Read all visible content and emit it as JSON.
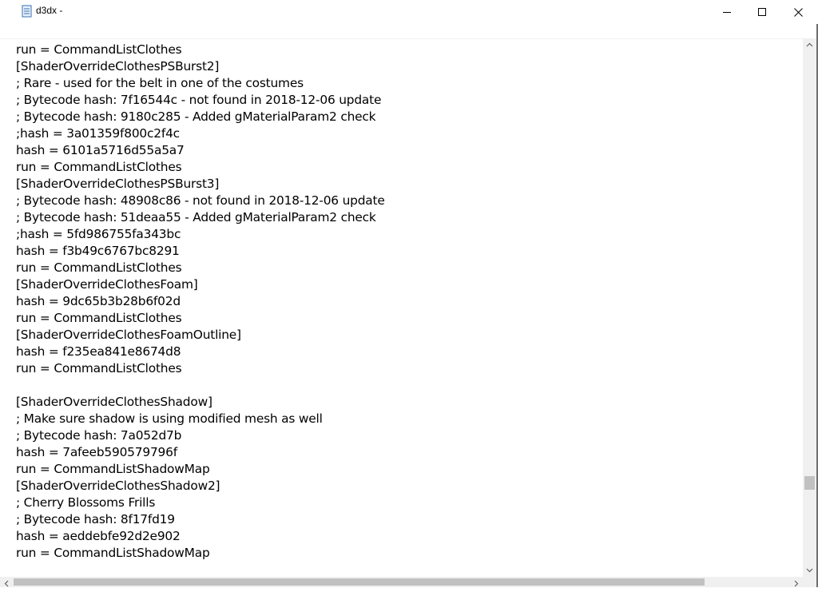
{
  "window": {
    "title": "d3dx - ",
    "icon": "notepad-icon",
    "minimize_icon": "minimize-icon",
    "maximize_icon": "maximize-icon",
    "close_icon": "close-icon"
  },
  "editor": {
    "lines": [
      "run = CommandListClothes",
      "[ShaderOverrideClothesPSBurst2]",
      "; Rare - used for the belt in one of the costumes",
      "; Bytecode hash: 7f16544c - not found in 2018-12-06 update",
      "; Bytecode hash: 9180c285 - Added gMaterialParam2 check",
      ";hash = 3a01359f800c2f4c",
      "hash = 6101a5716d55a5a7",
      "run = CommandListClothes",
      "[ShaderOverrideClothesPSBurst3]",
      "; Bytecode hash: 48908c86 - not found in 2018-12-06 update",
      "; Bytecode hash: 51deaa55 - Added gMaterialParam2 check",
      ";hash = 5fd986755fa343bc",
      "hash = f3b49c6767bc8291",
      "run = CommandListClothes",
      "[ShaderOverrideClothesFoam]",
      "hash = 9dc65b3b28b6f02d",
      "run = CommandListClothes",
      "[ShaderOverrideClothesFoamOutline]",
      "hash = f235ea841e8674d8",
      "run = CommandListClothes",
      "",
      "[ShaderOverrideClothesShadow]",
      "; Make sure shadow is using modified mesh as well",
      "; Bytecode hash: 7a052d7b",
      "hash = 7afeeb590579796f",
      "run = CommandListShadowMap",
      "[ShaderOverrideClothesShadow2]",
      "; Cherry Blossoms Frills",
      "; Bytecode hash: 8f17fd19",
      "hash = aeddebfe92d2e902",
      "run = CommandListShadowMap"
    ]
  },
  "scrollbars": {
    "vertical_position": 0.82,
    "horizontal_visible_fraction": 0.87
  }
}
